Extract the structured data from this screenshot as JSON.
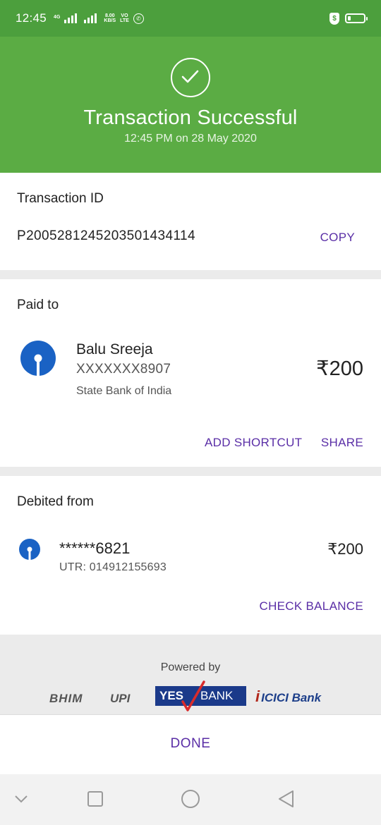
{
  "status_bar": {
    "time": "12:45",
    "network": "4G",
    "speed_value": "8.00",
    "speed_unit": "KB/S",
    "volte_top": "VO",
    "volte_bottom": "LTE",
    "battery_fill": 0.2,
    "icons": [
      "signal-icon",
      "whatsapp-icon",
      "shield-icon",
      "battery-icon"
    ]
  },
  "header": {
    "title": "Transaction Successful",
    "subtitle": "12:45 PM on 28 May 2020",
    "icon": "check-circle-icon",
    "color": "#5bac44"
  },
  "transaction": {
    "label": "Transaction ID",
    "id": "P2005281245203501434114",
    "copy_label": "COPY"
  },
  "paid_to": {
    "label": "Paid to",
    "name": "Balu Sreeja",
    "account": "XXXXXXX8907",
    "bank": "State Bank of India",
    "amount": "₹200",
    "add_shortcut_label": "ADD SHORTCUT",
    "share_label": "SHARE"
  },
  "debited_from": {
    "label": "Debited from",
    "account": "******6821",
    "utr": "UTR: 014912155693",
    "amount": "₹200",
    "check_balance_label": "CHECK BALANCE"
  },
  "powered_by": {
    "text": "Powered by",
    "bhim": "BHIM",
    "upi": "UPI",
    "yes": "YES",
    "bank": "BANK",
    "icici": "ICICI Bank"
  },
  "done_label": "DONE",
  "accent_color": "#5a2ea6"
}
